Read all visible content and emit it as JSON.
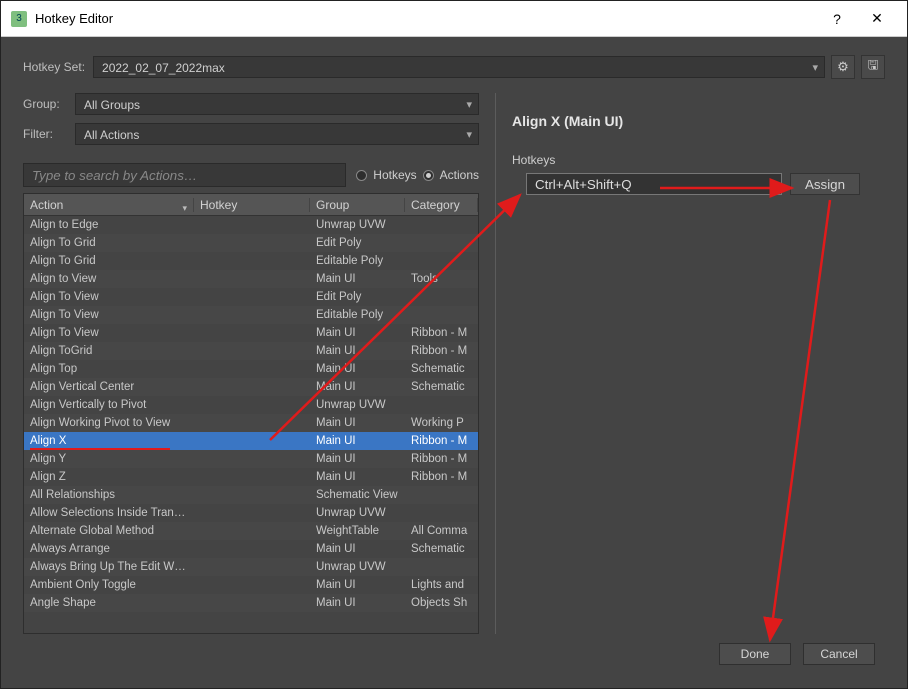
{
  "window": {
    "title": "Hotkey Editor"
  },
  "hotkey_set": {
    "label": "Hotkey Set:",
    "value": "2022_02_07_2022max"
  },
  "group": {
    "label": "Group:",
    "value": "All Groups"
  },
  "filter": {
    "label": "Filter:",
    "value": "All Actions"
  },
  "search": {
    "placeholder": "Type to search by Actions…"
  },
  "radios": {
    "hotkeys": "Hotkeys",
    "actions": "Actions",
    "selected": "actions"
  },
  "columns": {
    "action": "Action",
    "hotkey": "Hotkey",
    "group": "Group",
    "category": "Category"
  },
  "rows": [
    {
      "action": "Align to Edge",
      "hotkey": "",
      "group": "Unwrap UVW",
      "category": ""
    },
    {
      "action": "Align To Grid",
      "hotkey": "",
      "group": "Edit Poly",
      "category": ""
    },
    {
      "action": "Align To Grid",
      "hotkey": "",
      "group": "Editable Poly",
      "category": ""
    },
    {
      "action": "Align to View",
      "hotkey": "",
      "group": "Main UI",
      "category": "Tools"
    },
    {
      "action": "Align To View",
      "hotkey": "",
      "group": "Edit Poly",
      "category": ""
    },
    {
      "action": "Align To View",
      "hotkey": "",
      "group": "Editable Poly",
      "category": ""
    },
    {
      "action": "Align To View",
      "hotkey": "",
      "group": "Main UI",
      "category": "Ribbon - M"
    },
    {
      "action": "Align ToGrid",
      "hotkey": "",
      "group": "Main UI",
      "category": "Ribbon - M"
    },
    {
      "action": "Align Top",
      "hotkey": "",
      "group": "Main UI",
      "category": "Schematic"
    },
    {
      "action": "Align Vertical Center",
      "hotkey": "",
      "group": "Main UI",
      "category": "Schematic"
    },
    {
      "action": "Align Vertically to Pivot",
      "hotkey": "",
      "group": "Unwrap UVW",
      "category": ""
    },
    {
      "action": "Align Working Pivot to View",
      "hotkey": "",
      "group": "Main UI",
      "category": "Working P"
    },
    {
      "action": "Align X",
      "hotkey": "",
      "group": "Main UI",
      "category": "Ribbon - M",
      "selected": true
    },
    {
      "action": "Align Y",
      "hotkey": "",
      "group": "Main UI",
      "category": "Ribbon - M"
    },
    {
      "action": "Align Z",
      "hotkey": "",
      "group": "Main UI",
      "category": "Ribbon - M"
    },
    {
      "action": "All Relationships",
      "hotkey": "",
      "group": "Schematic View",
      "category": ""
    },
    {
      "action": "Allow Selections Inside Tranform …",
      "hotkey": "",
      "group": "Unwrap UVW",
      "category": ""
    },
    {
      "action": "Alternate Global Method",
      "hotkey": "",
      "group": "WeightTable",
      "category": "All Comma"
    },
    {
      "action": "Always Arrange",
      "hotkey": "",
      "group": "Main UI",
      "category": "Schematic"
    },
    {
      "action": "Always Bring Up The Edit Window",
      "hotkey": "",
      "group": "Unwrap UVW",
      "category": ""
    },
    {
      "action": "Ambient Only Toggle",
      "hotkey": "",
      "group": "Main UI",
      "category": "Lights and"
    },
    {
      "action": "Angle Shape",
      "hotkey": "",
      "group": "Main UI",
      "category": "Objects Sh"
    }
  ],
  "detail": {
    "title": "Align X (Main UI)",
    "section_label": "Hotkeys",
    "input_value": "Ctrl+Alt+Shift+Q",
    "assign_label": "Assign"
  },
  "footer": {
    "done": "Done",
    "cancel": "Cancel"
  }
}
